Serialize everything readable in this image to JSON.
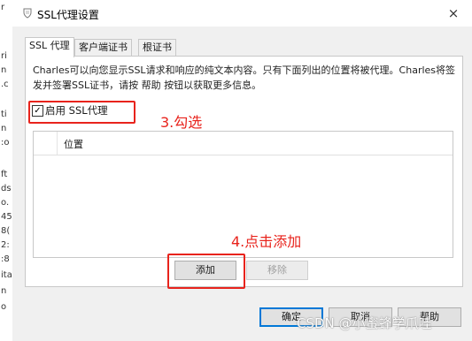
{
  "background": {
    "letters": [
      "r",
      "ri",
      "n",
      ".c",
      "ti",
      "n",
      ":o",
      "ft",
      "ds",
      "o.",
      "45",
      "8(",
      "2:",
      ":8",
      "ita",
      "n",
      "o"
    ]
  },
  "dialog": {
    "title": "SSL代理设置",
    "close_glyph": "×",
    "tabs": [
      {
        "label": "SSL 代理",
        "active": true
      },
      {
        "label": "客户端证书",
        "active": false
      },
      {
        "label": "根证书",
        "active": false
      }
    ],
    "description": "Charles可以向您显示SSL请求和响应的纯文本内容。只有下面列出的位置将被代理。Charles将签发并签署SSL证书，请按 帮助 按钮以获取更多信息。",
    "enable_ssl_checkbox": {
      "label": "启用 SSL代理",
      "checked": true,
      "check_glyph": "✓"
    },
    "locations_table": {
      "header": "位置",
      "rows": []
    },
    "add_button": "添加",
    "remove_button": "移除",
    "ok_button": "确定",
    "cancel_button": "取消",
    "help_button": "帮助"
  },
  "annotations": {
    "step3": "3.勾选",
    "step4": "4.点击添加",
    "color": "#e8231c"
  },
  "watermark": "CSDN @小蜜蜂学爪哇"
}
